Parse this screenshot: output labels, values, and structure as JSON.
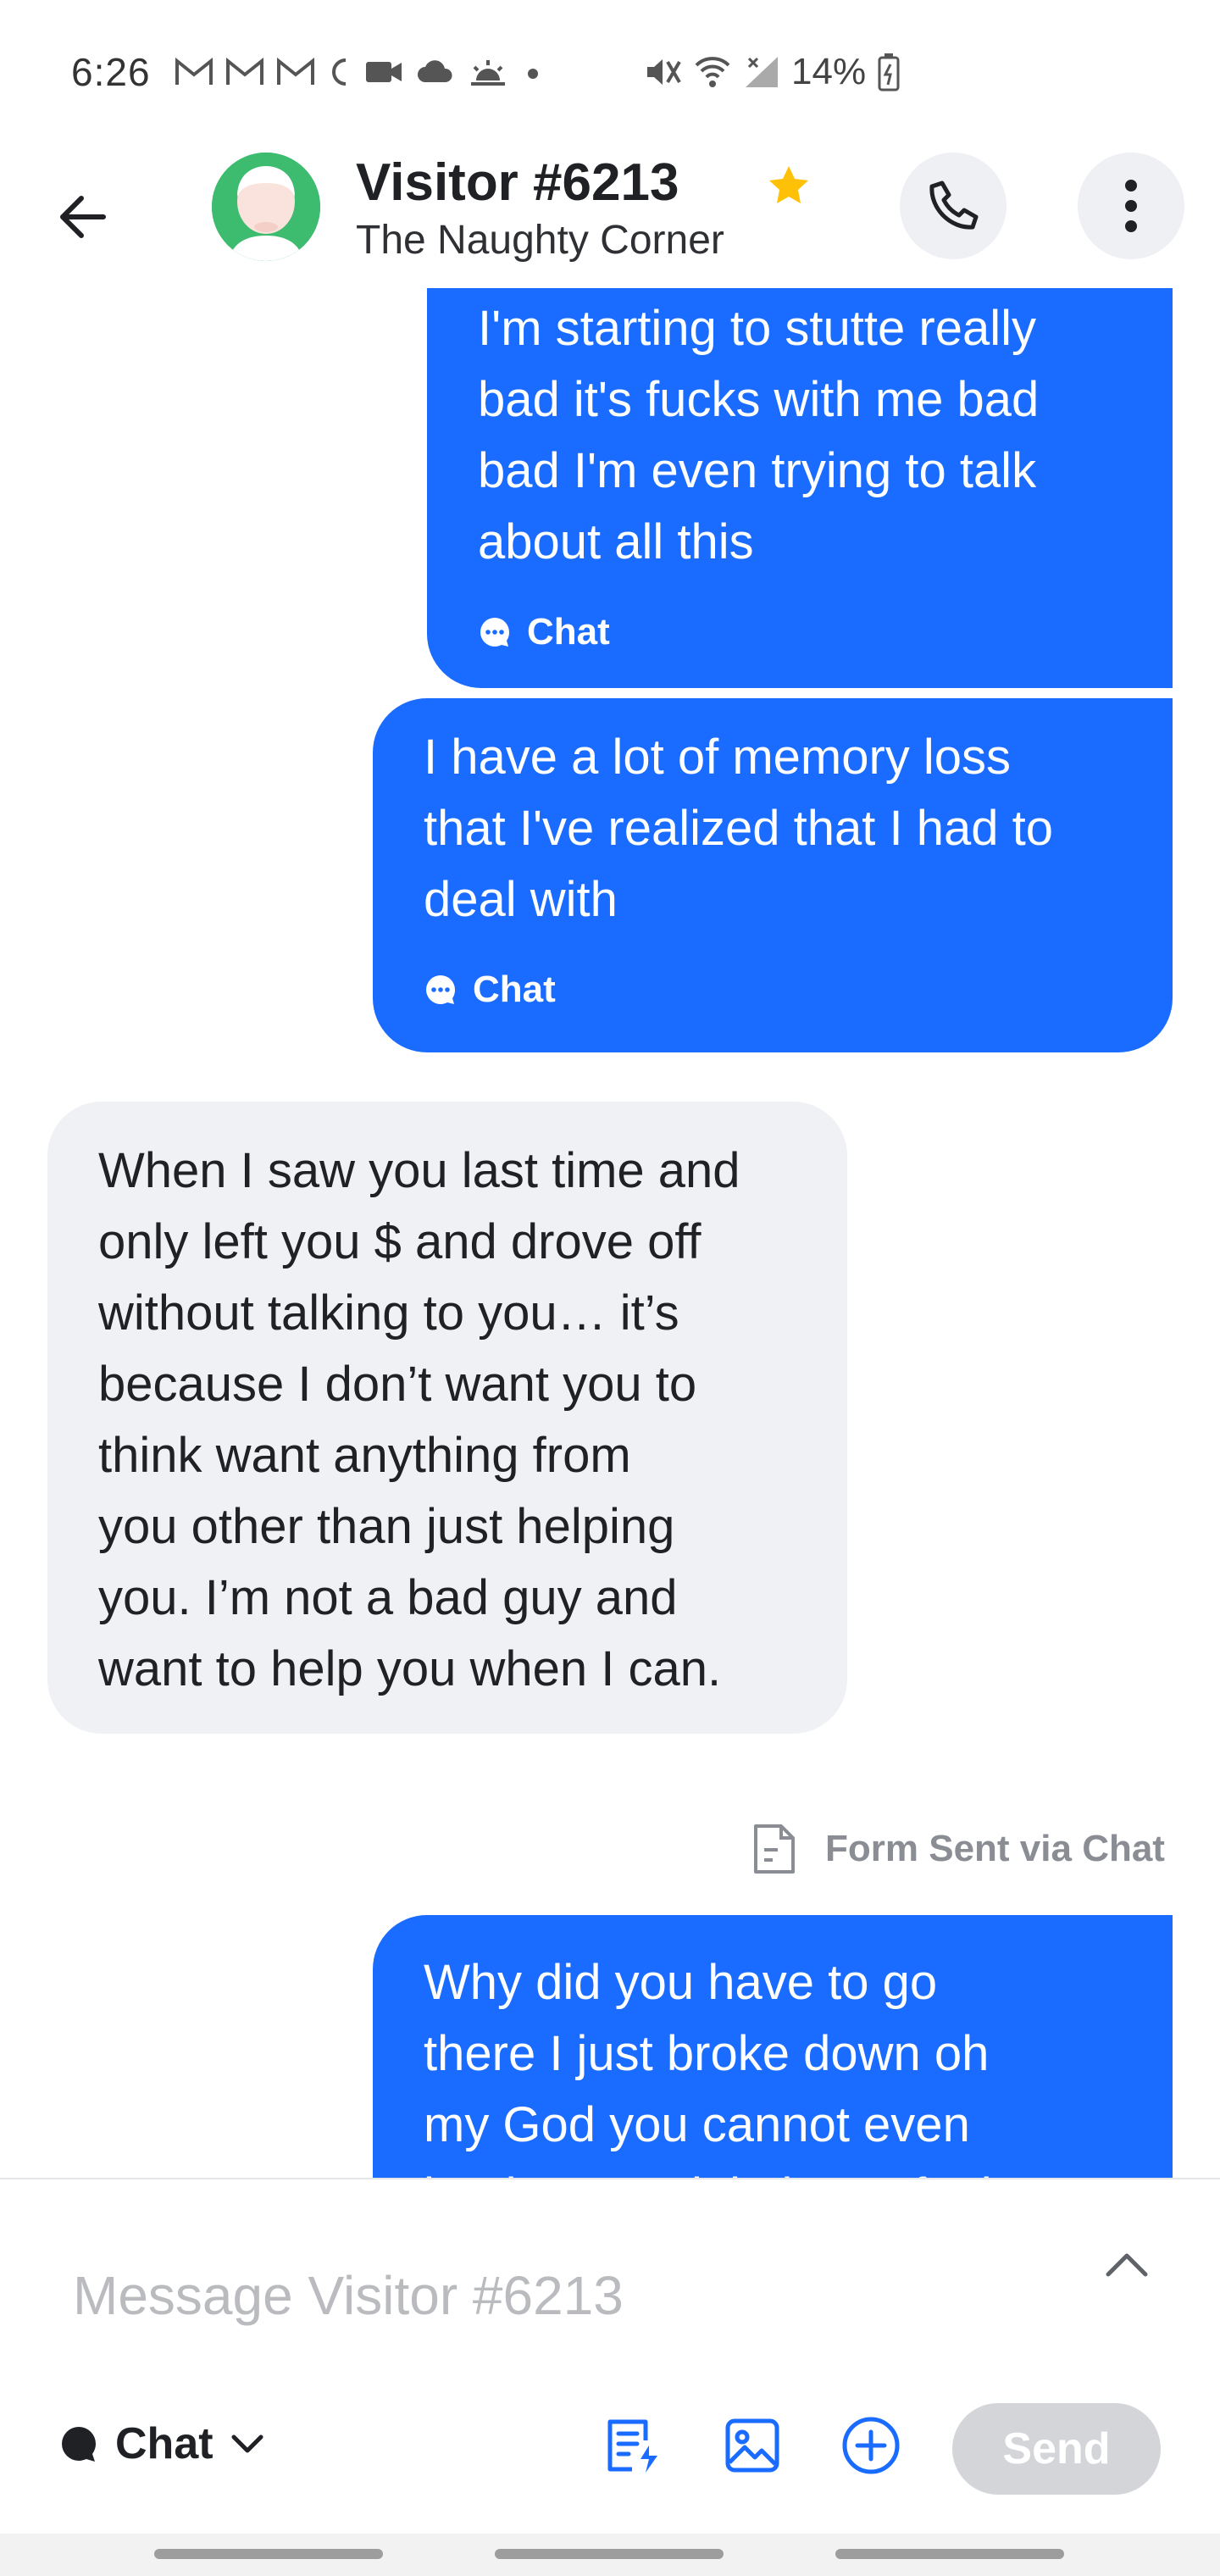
{
  "status_bar": {
    "time": "6:26",
    "battery": "14%",
    "left_icons": [
      "gmail-icon",
      "gmail-icon",
      "gmail-icon",
      "moon-icon",
      "video-icon",
      "cloud-icon",
      "sunrise-icon",
      "dot-icon"
    ],
    "right_icons": [
      "mute-icon",
      "wifi-icon",
      "signal-icon",
      "battery-icon"
    ]
  },
  "header": {
    "title": "Visitor #6213",
    "subtitle": "The Naughty Corner",
    "starred": true,
    "avatar_color": "#3dbb6e",
    "star_color": "#ffc107"
  },
  "messages": [
    {
      "direction": "outgoing",
      "text": "I'm starting to stutte really\nbad it's fucks with me bad\nbad I'm even trying to talk\nabout all this",
      "channel": "Chat"
    },
    {
      "direction": "outgoing",
      "text": "I have a lot of memory loss\nthat I've realized that I had to\ndeal with",
      "channel": "Chat"
    },
    {
      "direction": "incoming",
      "text": "When I saw you last time and\nonly left you $ and drove off\nwithout talking to you… it’s\nbecause I don’t want you to\nthink want anything from\nyou other than just helping\nyou. I’m not a bad guy and\nwant to help you when I can."
    },
    {
      "direction": "outgoing",
      "text": "Why did you have to go\nthere I just broke down oh\nmy God you cannot even\nbegin to explain how I feel"
    }
  ],
  "form_sent_label": "Form Sent via Chat",
  "composer": {
    "placeholder": "Message Visitor #6213",
    "value": "",
    "channel_label": "Chat",
    "send_label": "Send"
  },
  "colors": {
    "outgoing_bubble": "#1a6bff",
    "incoming_bubble": "#f0f1f4",
    "accent_icon": "#1a6bff",
    "send_disabled": "#d3d5d9"
  }
}
